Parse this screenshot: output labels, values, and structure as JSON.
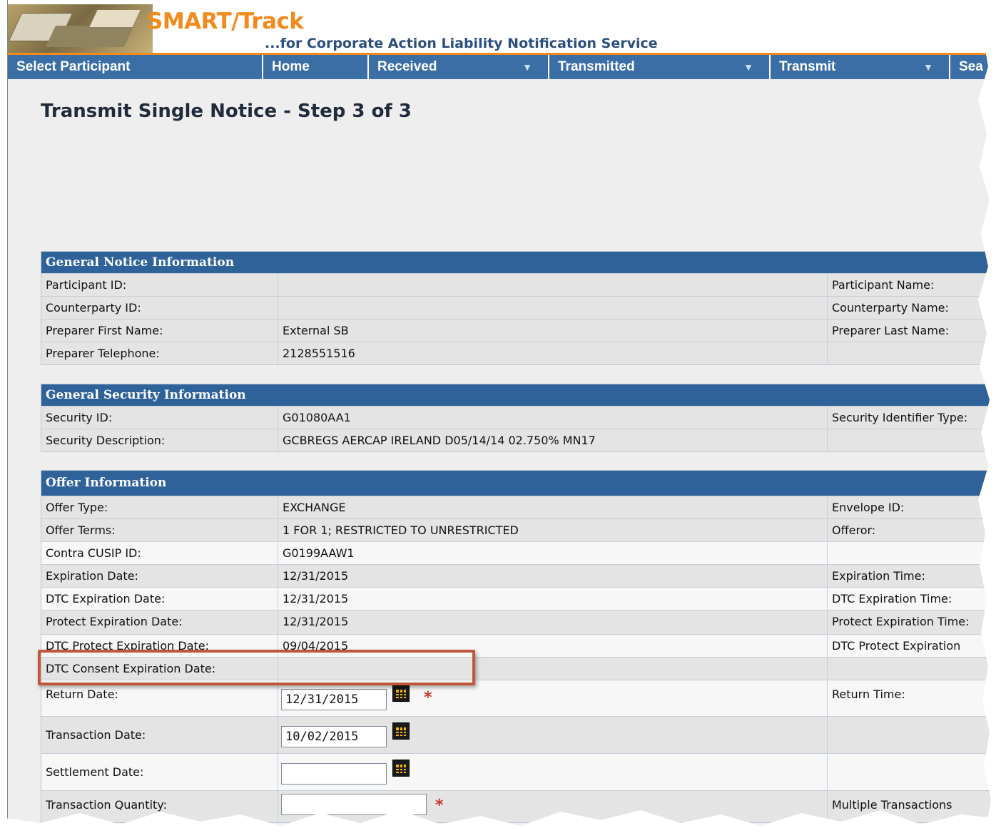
{
  "app": {
    "title": "SMART/Track",
    "tagline": "...for Corporate Action Liability Notification Service"
  },
  "nav": {
    "items": [
      {
        "label": "Select Participant",
        "has_dropdown": false
      },
      {
        "label": "Home",
        "has_dropdown": false
      },
      {
        "label": "Received",
        "has_dropdown": true
      },
      {
        "label": "Transmitted",
        "has_dropdown": true
      },
      {
        "label": "Transmit",
        "has_dropdown": true
      },
      {
        "label": "Sea",
        "has_dropdown": false
      }
    ],
    "dropdown_arrow": "▼"
  },
  "page": {
    "title": "Transmit Single Notice - Step 3 of 3"
  },
  "general_notice": {
    "header": "General Notice Information",
    "rows": [
      {
        "label": "Participant ID:",
        "value": "",
        "right_label": "Participant Name:"
      },
      {
        "label": "Counterparty ID:",
        "value": "",
        "right_label": "Counterparty Name:"
      },
      {
        "label": "Preparer First Name:",
        "value": "External SB",
        "right_label": "Preparer Last Name:"
      },
      {
        "label": "Preparer Telephone:",
        "value": "2128551516",
        "right_label": ""
      }
    ]
  },
  "general_security": {
    "header": "General Security Information",
    "rows": [
      {
        "label": "Security ID:",
        "value": "G01080AA1",
        "right_label": "Security Identifier Type:"
      },
      {
        "label": "Security Description:",
        "value": "GCBREGS AERCAP IRELAND D05/14/14 02.750% MN17",
        "right_label": ""
      }
    ]
  },
  "offer": {
    "header": "Offer Information",
    "rows": [
      {
        "label": "Offer Type:",
        "value": "EXCHANGE",
        "right_label": "Envelope ID:"
      },
      {
        "label": "Offer Terms:",
        "value": "1 FOR 1; RESTRICTED TO UNRESTRICTED",
        "right_label": "Offeror:"
      },
      {
        "label": "Contra CUSIP ID:",
        "value": "G0199AAW1",
        "right_label": ""
      },
      {
        "label": "Expiration Date:",
        "value": "12/31/2015",
        "right_label": "Expiration Time:"
      },
      {
        "label": "DTC Expiration Date:",
        "value": "12/31/2015",
        "right_label": "DTC Expiration Time:"
      },
      {
        "label": "Protect Expiration Date:",
        "value": "12/31/2015",
        "right_label": "Protect Expiration Time:"
      },
      {
        "label": "DTC Protect Expiration Date:",
        "value": "09/04/2015",
        "right_label": "DTC Protect Expiration"
      },
      {
        "label": "DTC Consent Expiration Date:",
        "value": "",
        "right_label": ""
      }
    ],
    "inputs": {
      "return_date": {
        "label": "Return Date:",
        "value": "12/31/2015",
        "right_label": "Return Time:"
      },
      "transaction_date": {
        "label": "Transaction Date:",
        "value": "10/02/2015"
      },
      "settlement_date": {
        "label": "Settlement Date:",
        "value": ""
      },
      "transaction_quantity": {
        "label": "Transaction Quantity:",
        "value": "",
        "right_label": "Multiple Transactions"
      }
    },
    "required_mark": "*"
  },
  "colors": {
    "brand_orange": "#f28a1c",
    "nav_blue": "#3a6ea5",
    "section_header_blue": "#2f6299",
    "highlight_red": "#c0573a",
    "required_red": "#c0392b"
  },
  "icons": {
    "calendar": "calendar-icon",
    "dropdown": "triangle-down-icon"
  }
}
